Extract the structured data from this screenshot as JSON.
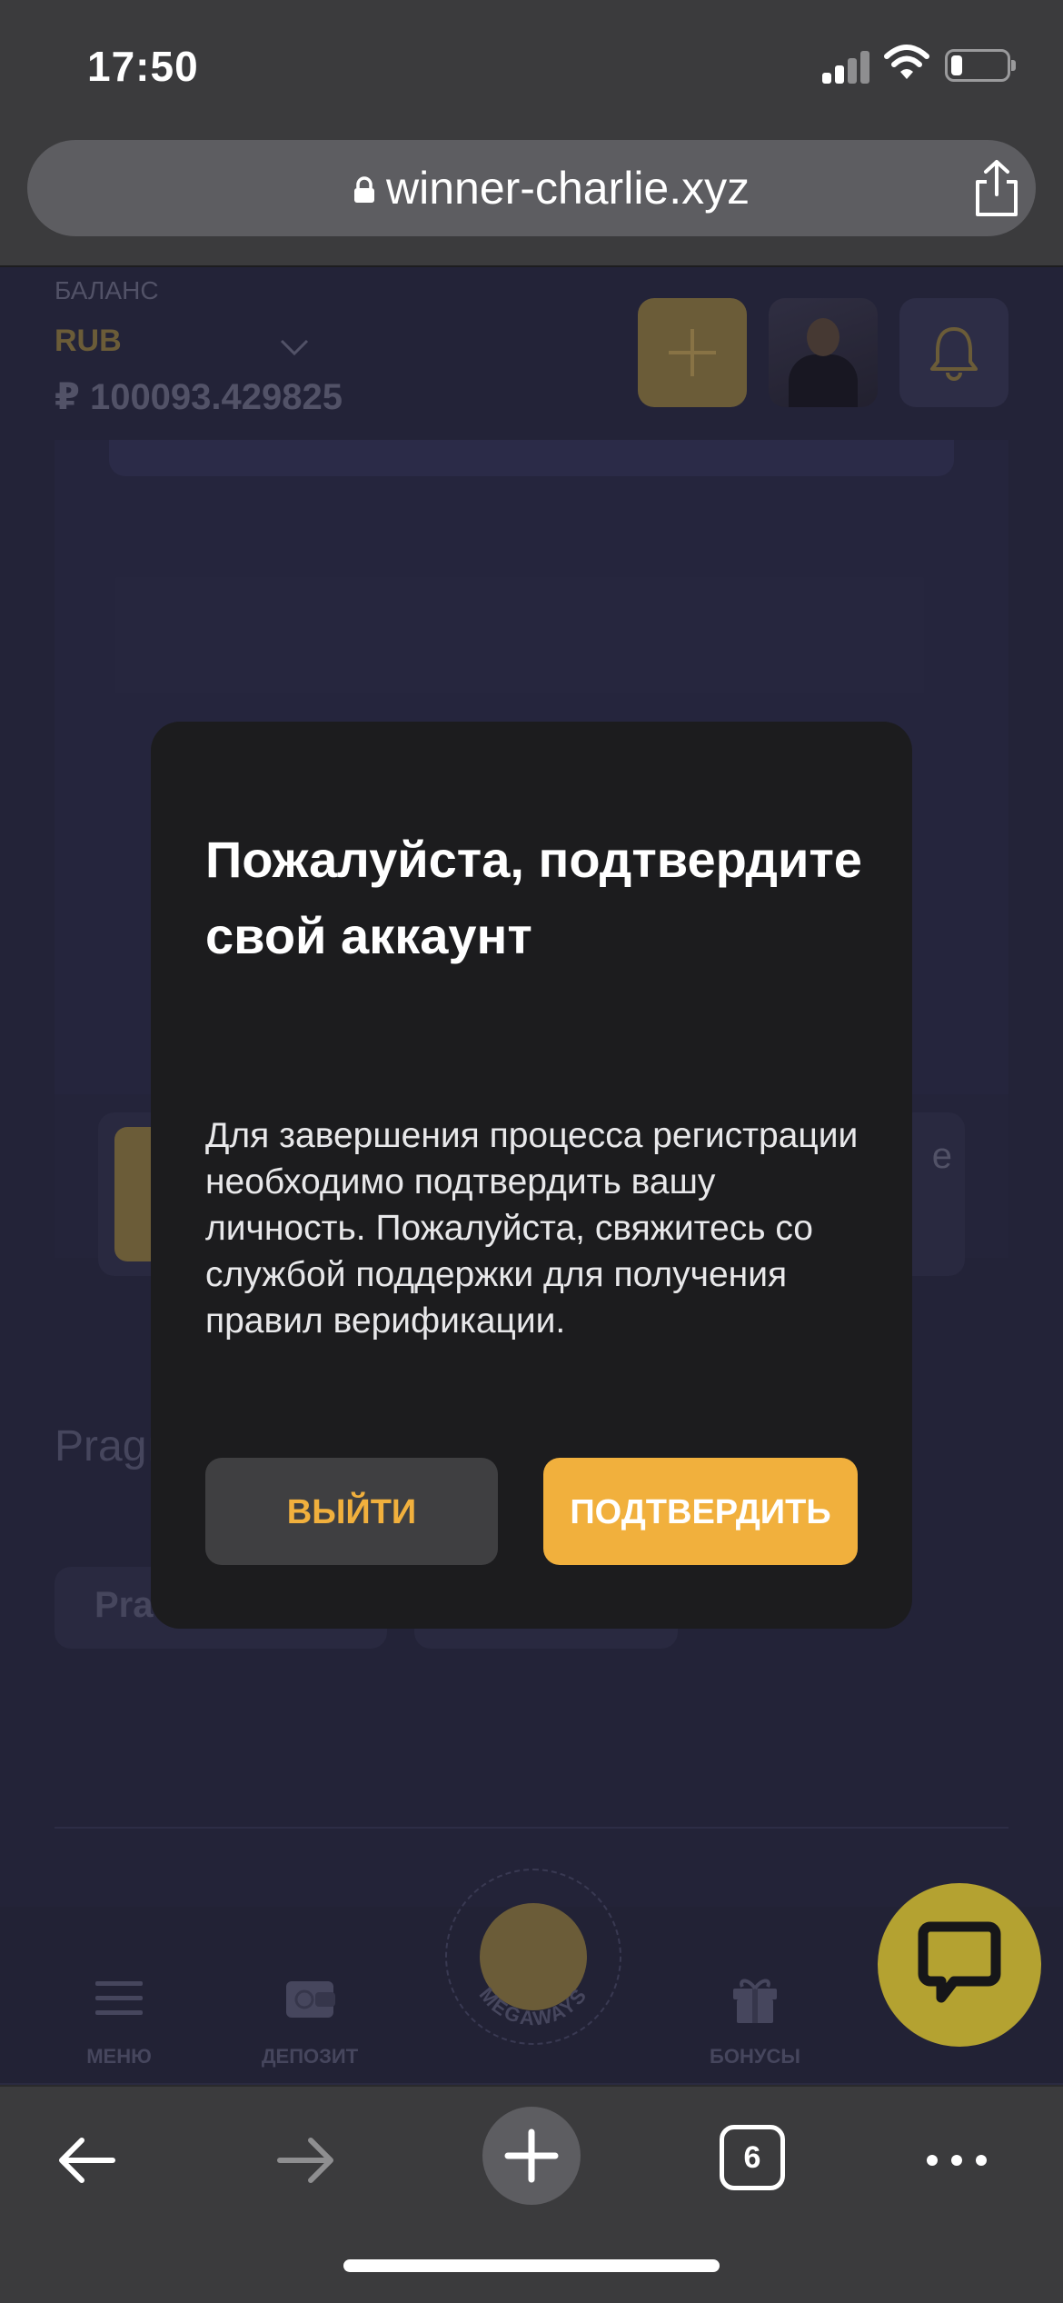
{
  "status_bar": {
    "time": "17:50"
  },
  "browser": {
    "url": "winner-charlie.xyz",
    "tab_count": "6"
  },
  "page": {
    "balance_label": "БАЛАНС",
    "currency": "RUB",
    "balance_value": "₽ 100093.429825",
    "strip_fragment": "e",
    "section_title": "Pragı",
    "pill_label": "Pra"
  },
  "nav": {
    "menu": "МЕНЮ",
    "deposit": "ДЕПОЗИТ",
    "center_badge": "MEGAWAYS",
    "bonuses": "БОНУСЫ"
  },
  "modal": {
    "title": "Пожалуйста, подтвердите свой аккаунт",
    "body": "Для завершения процесса регистрации необходимо подтвердить вашу личность. Пожалуйста, свяжитесь со службой поддержки для получения правил верификации.",
    "exit_label": "ВЫЙТИ",
    "confirm_label": "ПОДТВЕРДИТЬ"
  },
  "colors": {
    "accent": "#f1b03d",
    "page_bg": "#2b2b44",
    "modal_bg": "#1c1c1e",
    "chat_bubble": "#f4dc3b",
    "browser_chrome": "#3b3b3d"
  },
  "icons": [
    "signal-icon",
    "wifi-icon",
    "battery-icon",
    "lock-icon",
    "share-icon",
    "chevron-down-icon",
    "plus-icon",
    "bell-icon",
    "menu-icon",
    "wallet-icon",
    "gift-icon",
    "chat-icon",
    "back-arrow-icon",
    "forward-arrow-icon",
    "new-tab-icon",
    "tabs-icon",
    "more-icon"
  ]
}
